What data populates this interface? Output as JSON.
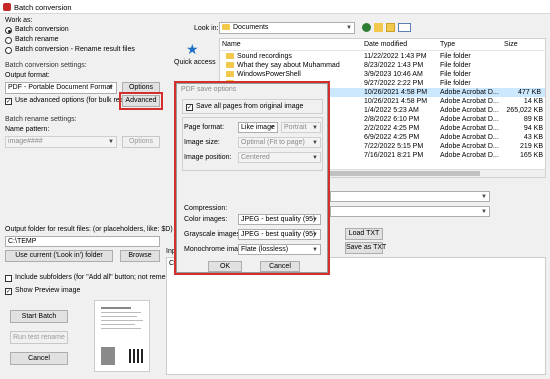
{
  "window": {
    "title": "Batch conversion"
  },
  "work_as": {
    "label": "Work as:",
    "options": [
      "Batch conversion",
      "Batch rename",
      "Batch conversion - Rename result files"
    ]
  },
  "conv_settings": {
    "label": "Batch conversion settings:",
    "output_format_label": "Output format:",
    "format_value": "PDF - Portable Document Format",
    "options_btn": "Options",
    "advanced_chk": "Use advanced options (for bulk resize...)",
    "advanced_btn": "Advanced"
  },
  "rename_settings": {
    "label": "Batch rename settings:",
    "pattern_label": "Name pattern:",
    "pattern_value": "image####",
    "options_btn": "Options"
  },
  "output": {
    "label": "Output folder for result files: (or placeholders, like: $D)",
    "value": "C:\\TEMP",
    "use_current_btn": "Use current ('Look in') folder",
    "browse_btn": "Browse"
  },
  "include_subfolders": "Include subfolders (for \"Add all\" button; not remembered)",
  "show_preview": "Show Preview image",
  "buttons": {
    "start": "Start Batch",
    "run_rename": "Run test rename",
    "cancel": "Cancel"
  },
  "browser": {
    "look_in_label": "Look in:",
    "look_in_value": "Documents",
    "quick_access": "Quick access",
    "columns": [
      "Name",
      "Date modified",
      "Type",
      "Size"
    ],
    "rows": [
      {
        "name": "Sound recordings",
        "date": "11/22/2022 1:43 PM",
        "type": "File folder",
        "size": ""
      },
      {
        "name": "What they say about Muhammad",
        "date": "8/23/2022 1:43 PM",
        "type": "File folder",
        "size": ""
      },
      {
        "name": "WindowsPowerShell",
        "date": "3/9/2023 10:46 AM",
        "type": "File folder",
        "size": ""
      },
      {
        "name": "",
        "date": "9/27/2022 2:22 PM",
        "type": "File folder",
        "size": ""
      },
      {
        "name": "",
        "date": "10/26/2021 4:58 PM",
        "type": "Adobe Acrobat D...",
        "size": "477 KB"
      },
      {
        "name": "",
        "date": "10/26/2021 4:58 PM",
        "type": "Adobe Acrobat D...",
        "size": "14 KB"
      },
      {
        "name": "",
        "date": "1/4/2022 5:23 AM",
        "type": "Adobe Acrobat D...",
        "size": "265,022 KB"
      },
      {
        "name": "",
        "date": "2/8/2022 6:10 PM",
        "type": "Adobe Acrobat D...",
        "size": "89 KB"
      },
      {
        "name": "",
        "date": "2/2/2022 4:25 PM",
        "type": "Adobe Acrobat D...",
        "size": "94 KB"
      },
      {
        "name": "",
        "date": "6/9/2022 4:25 PM",
        "type": "Adobe Acrobat D...",
        "size": "43 KB"
      },
      {
        "name": "",
        "date": "7/22/2022 5:15 PM",
        "type": "Adobe Acrobat D...",
        "size": "219 KB"
      },
      {
        "name": "",
        "date": "7/16/2021 8:21 PM",
        "type": "Adobe Acrobat D...",
        "size": "165 KB"
      }
    ],
    "load_txt": "Load TXT",
    "save_txt": "Save as TXT",
    "input_files_label": "Inp",
    "list_first": "C:"
  },
  "pdf_dialog": {
    "title": "PDF save options",
    "save_all_pages": "Save all pages from original image",
    "page_format_label": "Page format:",
    "page_format_value": "Like image",
    "orientation_value": "Portrait",
    "image_size_label": "Image size:",
    "image_size_value": "Optimal (Fit to page)",
    "image_position_label": "Image position:",
    "image_position_value": "Centered",
    "compression_label": "Compression:",
    "color_label": "Color images:",
    "color_value": "JPEG - best quality (95)",
    "gray_label": "Grayscale images:",
    "gray_value": "JPEG - best quality (95)",
    "mono_label": "Monochrome images:",
    "mono_value": "Flate (lossless)",
    "ok": "OK",
    "cancel": "Cancel"
  },
  "colors": {
    "highlight_red": "#d32f2f",
    "selection": "#cce8ff"
  }
}
